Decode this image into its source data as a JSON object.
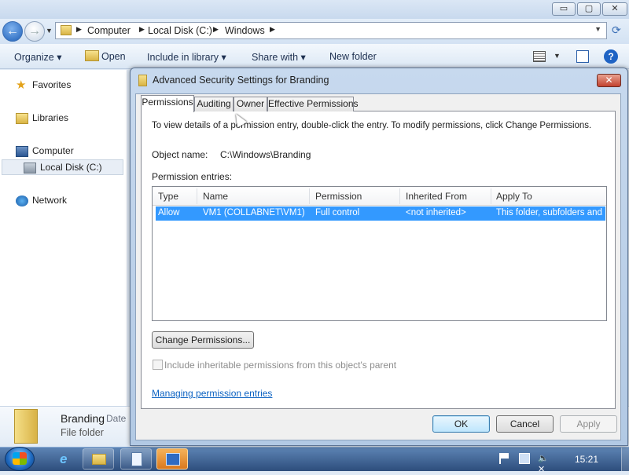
{
  "explorer": {
    "window_buttons": {
      "minimize": "▭",
      "maximize": "▢",
      "close": "✕"
    },
    "breadcrumbs": [
      "Computer",
      "Local Disk (C:)",
      "Windows"
    ],
    "toolbar": {
      "organize": "Organize ▾",
      "open": "Open",
      "include_in_library": "Include in library ▾",
      "share_with": "Share with ▾",
      "new_folder": "New folder"
    },
    "nav": {
      "favorites": "Favorites",
      "libraries": "Libraries",
      "computer": "Computer",
      "local_disk": "Local Disk (C:)",
      "network": "Network"
    },
    "details": {
      "name": "Branding",
      "date": "Date",
      "type": "File folder"
    }
  },
  "dialog": {
    "title": "Advanced Security Settings for Branding",
    "close_glyph": "✕",
    "tabs": [
      "Permissions",
      "Auditing",
      "Owner",
      "Effective Permissions"
    ],
    "instructions": "To view details of a permission entry, double-click the entry. To modify permissions, click Change Permissions.",
    "object_name_label": "Object name:",
    "object_name_value": "C:\\Windows\\Branding",
    "entries_label": "Permission entries:",
    "columns": [
      "Type",
      "Name",
      "Permission",
      "Inherited From",
      "Apply To"
    ],
    "rows": [
      {
        "type": "Allow",
        "name": "VM1 (COLLABNET\\VM1)",
        "permission": "Full control",
        "inherited_from": "<not inherited>",
        "apply_to": "This folder, subfolders and..."
      }
    ],
    "change_permissions": "Change Permissions...",
    "include_inheritable": "Include inheritable permissions from this object's parent",
    "include_inheritable_checked": false,
    "managing_link": "Managing permission entries",
    "ok": "OK",
    "cancel": "Cancel",
    "apply": "Apply"
  },
  "taskbar": {
    "ie_glyph": "e",
    "volume_glyph": "🔈✕",
    "clock": "15:21"
  },
  "colors": {
    "selection": "#3399ff",
    "link": "#0b62c2",
    "taskbar": "#2d4d7c"
  }
}
